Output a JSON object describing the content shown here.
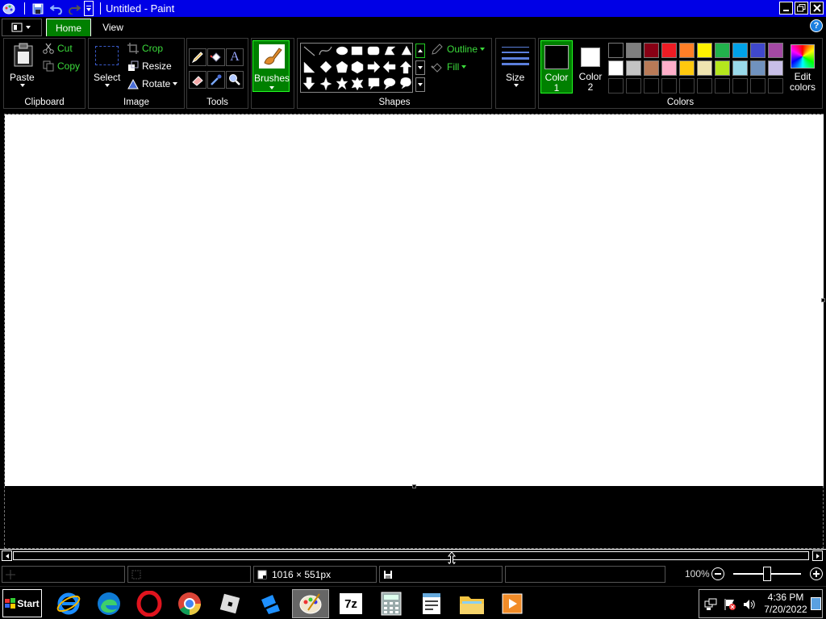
{
  "window": {
    "title": "Untitled - Paint"
  },
  "tabs": [
    {
      "label": "Home"
    },
    {
      "label": "View"
    }
  ],
  "ribbon": {
    "clipboard": {
      "paste": "Paste",
      "cut": "Cut",
      "copy": "Copy",
      "label": "Clipboard"
    },
    "image": {
      "select": "Select",
      "crop": "Crop",
      "resize": "Resize",
      "rotate": "Rotate",
      "label": "Image"
    },
    "tools": {
      "label": "Tools"
    },
    "brushes": {
      "label": "Brushes"
    },
    "shapes": {
      "outline": "Outline",
      "fill": "Fill",
      "label": "Shapes"
    },
    "size": {
      "label": "Size"
    },
    "colors": {
      "color1": "Color 1",
      "color2": "Color 2",
      "edit": "Edit colors",
      "label": "Colors",
      "color1_value": "#000000",
      "color2_value": "#ffffff",
      "row1": [
        "#000000",
        "#7f7f7f",
        "#880015",
        "#ed1c24",
        "#ff7f27",
        "#fff200",
        "#22b14c",
        "#00a2e8",
        "#3f48cc",
        "#a349a4"
      ],
      "row2": [
        "#ffffff",
        "#c3c3c3",
        "#b97a57",
        "#ffaec9",
        "#ffc90e",
        "#efe4b0",
        "#b5e61d",
        "#99d9ea",
        "#7092be",
        "#c8bfe7"
      ],
      "row3": [
        "#000000",
        "#000000",
        "#000000",
        "#000000",
        "#000000",
        "#000000",
        "#000000",
        "#000000",
        "#000000",
        "#000000"
      ]
    }
  },
  "status": {
    "dimensions": "1016 × 551px",
    "zoom": "100%",
    "zoom_level": 0.5
  },
  "taskbar": {
    "start": "Start",
    "time": "4:36 PM",
    "date": "7/20/2022"
  }
}
